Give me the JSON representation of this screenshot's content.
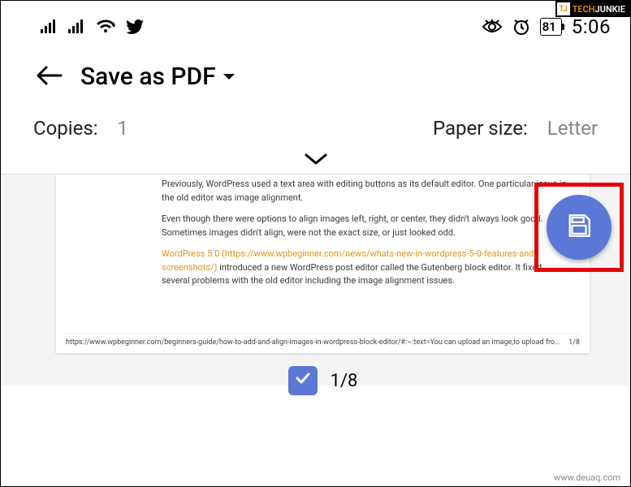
{
  "watermark_top": {
    "tech": "TECH",
    "junkie": "JUNKIE",
    "tj": "TJ"
  },
  "status": {
    "battery": "81",
    "time": "5:06"
  },
  "appbar": {
    "title": "Save as PDF"
  },
  "settings": {
    "copies_label": "Copies:",
    "copies_value": "1",
    "paper_label": "Paper size:",
    "paper_value": "Letter"
  },
  "preview": {
    "p1": "Previously, WordPress used a text area with editing buttons as its default editor. One particular issue in the old editor was image alignment.",
    "p2": "Even though there were options to align images left, right, or center, they didn't always look good. Sometimes images didn't align, were not the exact size, or just looked odd.",
    "link": "WordPress 5.0 (https://www.wpbeginner.com/news/whats-new-in-wordpress-5-0-features-and-screenshots/)",
    "p3_rest": " introduced a new WordPress post editor called the Gutenberg block editor. It fixed several problems with the old editor including the image alignment issues.",
    "footer_url": "https://www.wpbeginner.com/beginners-guide/how-to-add-and-align-images-in-wordpress-block-editor/#:~:text=You can upload an image,to upload fro...",
    "footer_page": "1/8"
  },
  "page_indicator": {
    "text": "1/8"
  },
  "watermark_bottom": "www.deuaq.com"
}
